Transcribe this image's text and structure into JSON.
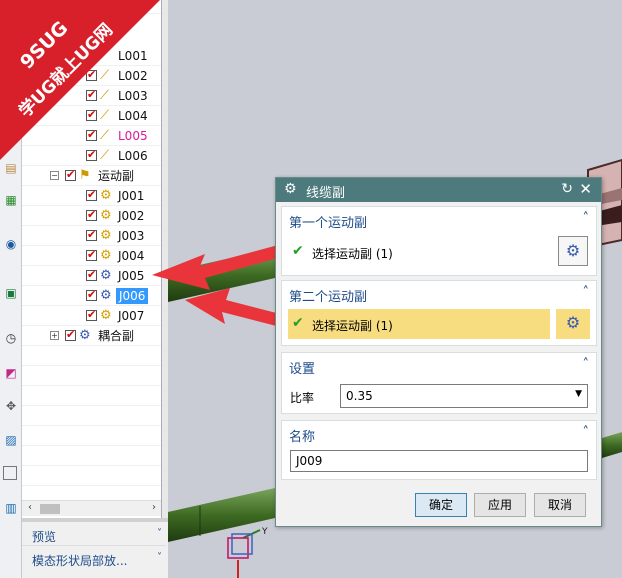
{
  "watermark": {
    "line1": "9SUG",
    "line2": "学UG就上UG网"
  },
  "navigator": {
    "top_partial": "974",
    "links": [
      "L001",
      "L002",
      "L003",
      "L004",
      "L005",
      "L006"
    ],
    "folder_motion": "运动副",
    "joints": [
      "J001",
      "J002",
      "J003",
      "J004",
      "J005",
      "J006",
      "J007"
    ],
    "folder_coupler": "耦合副",
    "panels": [
      "预览",
      "模态形状局部放..."
    ]
  },
  "colors": {
    "highlight_link": "#e0189a",
    "title_bar": "#4d7a7c",
    "selection": "#3399ff"
  },
  "dialog": {
    "title": "线缆副",
    "section1": {
      "header": "第一个运动副",
      "label": "选择运动副 (1)"
    },
    "section2": {
      "header": "第二个运动副",
      "label": "选择运动副 (1)"
    },
    "settings": {
      "header": "设置",
      "ratio_label": "比率",
      "ratio_value": "0.35"
    },
    "name": {
      "header": "名称",
      "value": "J009"
    },
    "buttons": {
      "ok": "确定",
      "apply": "应用",
      "cancel": "取消"
    }
  },
  "axis": {
    "y": "Y",
    "x": "X"
  }
}
